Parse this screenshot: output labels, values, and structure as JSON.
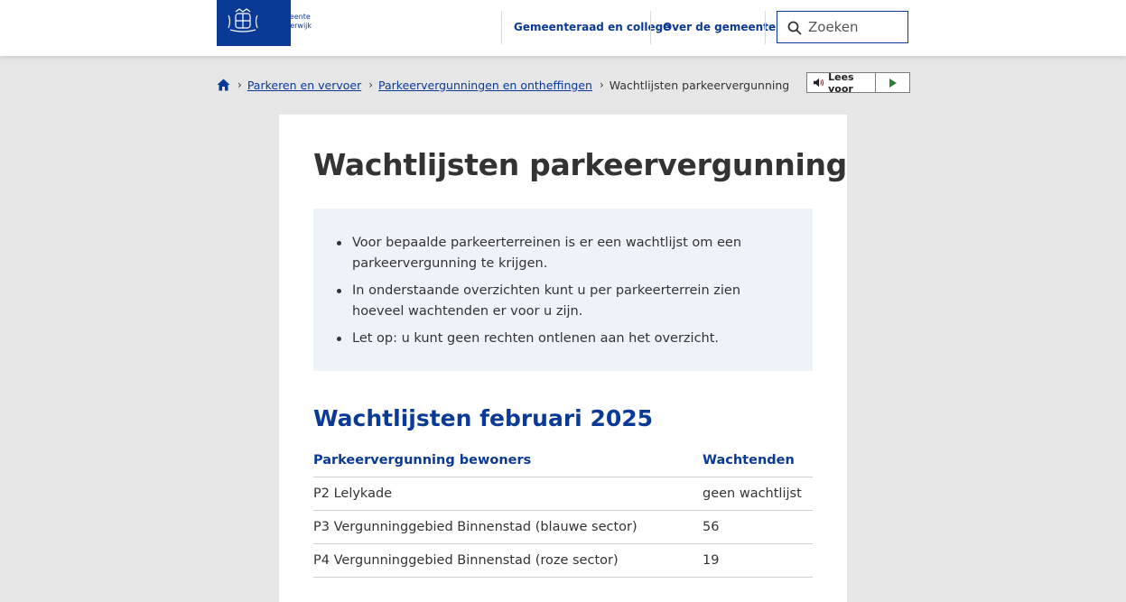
{
  "header": {
    "logo_text_line1": "gemeente",
    "logo_text_line2": "harderwijk",
    "nav": [
      "Gemeenteraad en college",
      "Over de gemeente"
    ],
    "search_placeholder": "Zoeken"
  },
  "breadcrumb": {
    "items": [
      "Parkeren en vervoer",
      "Parkeervergunningen en ontheffingen"
    ],
    "current": "Wachtlijsten parkeervergunning"
  },
  "readaloud": {
    "label": "Lees voor"
  },
  "page": {
    "title": "Wachtlijsten parkeervergunning",
    "intro_bullets": [
      "Voor bepaalde parkeerterreinen is er een wachtlijst om een parkeervergunning te krijgen.",
      "In onderstaande overzichten kunt u per parkeerterrein zien hoeveel wachtenden er voor u zijn.",
      "Let op: u kunt geen rechten ontlenen aan het overzicht."
    ],
    "section_title": "Wachtlijsten februari 2025",
    "table": {
      "headers": [
        "Parkeervergunning bewoners",
        "Wachtenden"
      ],
      "rows": [
        [
          "P2 Lelykade",
          "geen wachtlijst"
        ],
        [
          "P3 Vergunninggebied Binnenstad (blauwe sector)",
          "56"
        ],
        [
          "P4 Vergunninggebied Binnenstad (roze sector)",
          "19"
        ]
      ]
    }
  },
  "colors": {
    "brand": "#0b3a96",
    "background": "#e6e6e6",
    "intro_bg": "#eef3f9"
  }
}
